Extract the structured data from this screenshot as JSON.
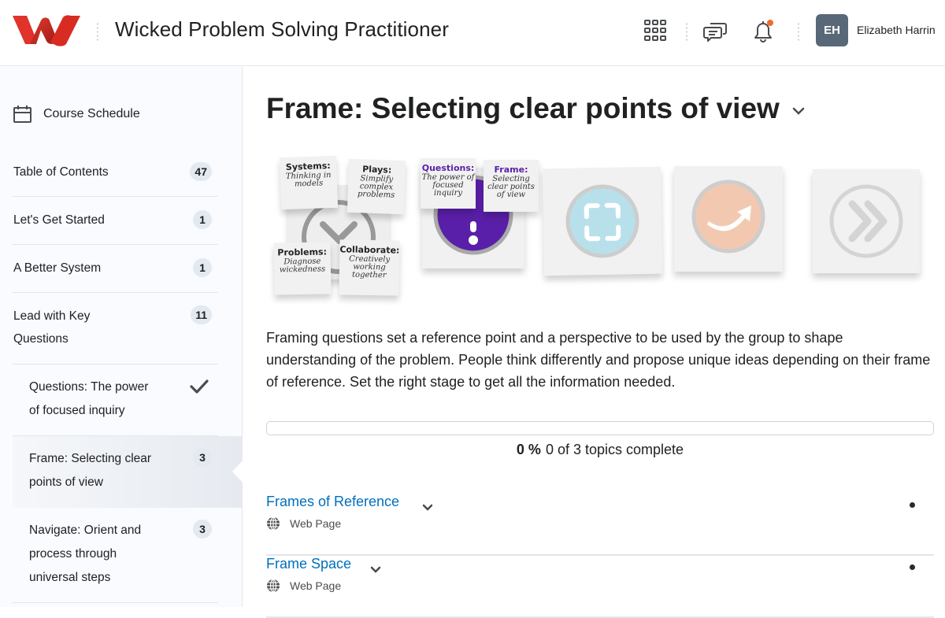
{
  "header": {
    "logo": "wicked-w-logo",
    "course_title": "Wicked Problem Solving Practitioner",
    "icons": [
      "apps-grid-icon",
      "chat-icon",
      "bell-icon"
    ],
    "notification_dot_color": "#f06b2a",
    "user_initials": "EH",
    "user_name": "Elizabeth Harrin"
  },
  "sidebar": {
    "schedule_label": "Course Schedule",
    "items": [
      {
        "label": "Table of Contents",
        "badge": "47"
      },
      {
        "label": "Let's Get Started",
        "badge": "1"
      },
      {
        "label": "A Better System",
        "badge": "1"
      },
      {
        "label_line1": "Lead with Key",
        "label_line2": "Questions",
        "badge": "11"
      },
      {
        "label_line1": "Questions: The power",
        "label_line2": "of focused inquiry",
        "status": "complete-check"
      },
      {
        "label_line1": "Frame: Selecting clear",
        "label_line2": "points of view",
        "badge": "3",
        "active": true
      },
      {
        "label_line1": "Navigate: Orient and",
        "label_line2": "process through",
        "label_line3": "universal steps",
        "badge": "3"
      }
    ]
  },
  "main": {
    "title": "Frame: Selecting clear points of view",
    "banner": {
      "notes": [
        {
          "title": "Systems:",
          "body": "Thinking in models"
        },
        {
          "title": "Plays:",
          "body": "Simplify complex problems"
        },
        {
          "title": "Problems:",
          "body": "Diagnose wickedness"
        },
        {
          "title": "Collaborate:",
          "body": "Creatively working together"
        },
        {
          "title": "Questions:",
          "body": "The power of focused inquiry"
        },
        {
          "title": "Frame:",
          "body": "Selecting clear points of view"
        }
      ],
      "accent_purple": "#5a1fa8",
      "frame_blue": "#b8e0ea",
      "navigate_peach": "#f2c9b0"
    },
    "description": "Framing questions set a reference point and a perspective to be used by the group to shape understanding of the problem.  People think differently and propose unique ideas depending on their frame of reference.  Set the right stage to get all the information needed.",
    "progress": {
      "percent": 0,
      "percent_label": "0 %",
      "summary": "0 of 3 topics complete"
    },
    "topics": [
      {
        "title": "Frames of Reference",
        "type": "Web Page"
      },
      {
        "title": "Frame Space",
        "type": "Web Page"
      }
    ]
  }
}
